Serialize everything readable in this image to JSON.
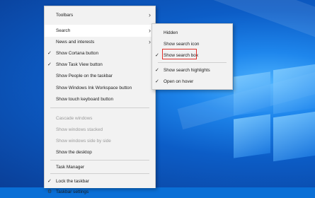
{
  "context_menu": {
    "items": [
      {
        "label": "Toolbars",
        "checked": false,
        "disabled": false,
        "submenu": true
      },
      {
        "label": "Search",
        "checked": false,
        "disabled": false,
        "submenu": true,
        "hover": true
      },
      {
        "label": "News and interests",
        "checked": false,
        "disabled": false,
        "submenu": true
      },
      {
        "label": "Show Cortana button",
        "checked": true,
        "disabled": false
      },
      {
        "label": "Show Task View button",
        "checked": true,
        "disabled": false
      },
      {
        "label": "Show People on the taskbar",
        "checked": false,
        "disabled": false
      },
      {
        "label": "Show Windows Ink Workspace button",
        "checked": false,
        "disabled": false
      },
      {
        "label": "Show touch keyboard button",
        "checked": false,
        "disabled": false
      },
      {
        "label": "Cascade windows",
        "checked": false,
        "disabled": true
      },
      {
        "label": "Show windows stacked",
        "checked": false,
        "disabled": true
      },
      {
        "label": "Show windows side by side",
        "checked": false,
        "disabled": true
      },
      {
        "label": "Show the desktop",
        "checked": false,
        "disabled": false
      },
      {
        "label": "Task Manager",
        "checked": false,
        "disabled": false
      },
      {
        "label": "Lock the taskbar",
        "checked": true,
        "disabled": false
      },
      {
        "label": "Taskbar settings",
        "checked": false,
        "disabled": false,
        "icon": "gear-icon"
      }
    ]
  },
  "search_submenu": {
    "items": [
      {
        "label": "Hidden",
        "checked": false
      },
      {
        "label": "Show search icon",
        "checked": false
      },
      {
        "label": "Show search box",
        "checked": true,
        "highlighted": true
      },
      {
        "label": "Show search highlights",
        "checked": true
      },
      {
        "label": "Open on hover",
        "checked": true
      }
    ]
  },
  "colors": {
    "menu_bg": "#f2f2f2",
    "highlight_border": "#e0312b",
    "desktop": "#0a6fd6"
  }
}
